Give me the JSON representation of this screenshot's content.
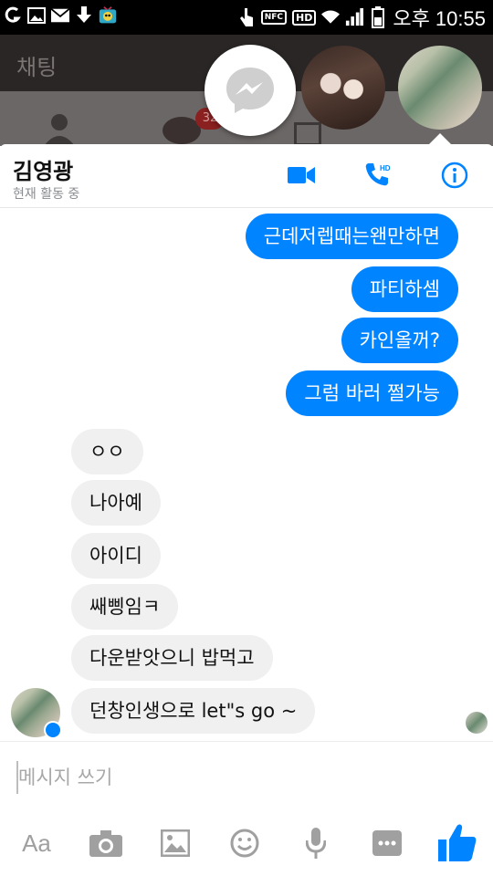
{
  "status_bar": {
    "time": "오후 10:55",
    "nfc": "NFC",
    "hd": "HD",
    "icons": [
      "g-icon",
      "photo-icon",
      "mail-icon",
      "download-icon",
      "tv-app-icon",
      "touch-icon",
      "wifi-icon",
      "signal-icon",
      "battery-icon"
    ]
  },
  "background_app": {
    "title": "채팅",
    "badge": "32"
  },
  "chat_header": {
    "name": "김영광",
    "status": "현재 활동 중"
  },
  "messages": {
    "out": [
      "근데저렙때는왠만하면",
      "파티하셈",
      "카인올꺼?",
      "그럼 바러 쩔가능"
    ],
    "in": [
      "ㅇㅇ",
      "나아예",
      "아이디",
      "쌔삥임ㅋ",
      "다운받앗으니 밥먹고",
      "던창인생으로 let\"s go ~"
    ]
  },
  "composer": {
    "placeholder": "메시지 쓰기"
  },
  "toolbar": {
    "aa_label": "Aa"
  },
  "colors": {
    "accent": "#0084ff",
    "incoming_bubble": "#f1f0f0",
    "icon_gray": "#a0a0a0"
  }
}
